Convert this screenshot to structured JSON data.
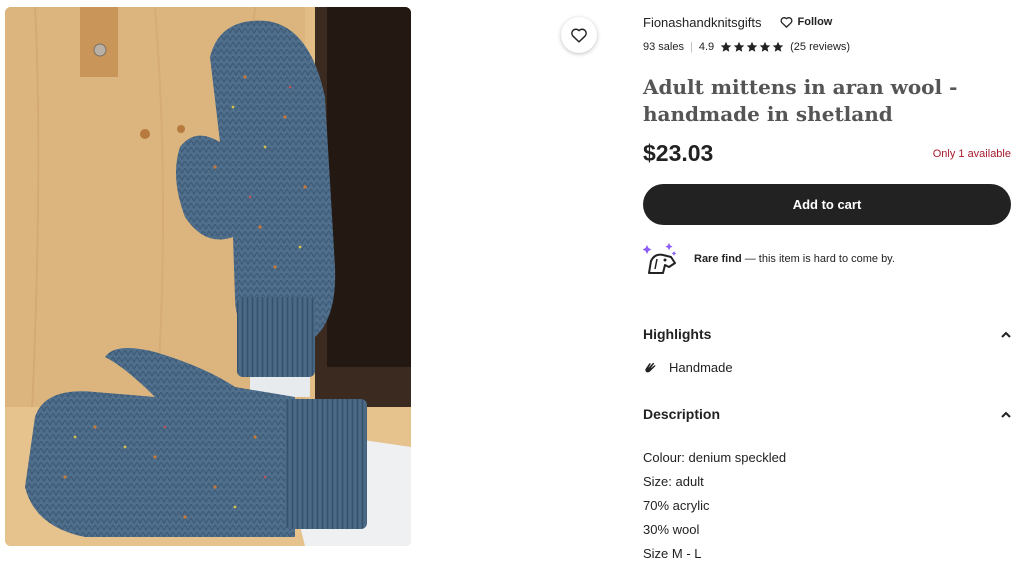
{
  "shop": {
    "name": "Fionashandknitsgifts",
    "follow_label": "Follow"
  },
  "stats": {
    "sales": "93 sales",
    "rating": "4.9",
    "reviews": "(25 reviews)"
  },
  "product": {
    "title": "Adult mittens in aran wool - handmade in shetland",
    "price": "$23.03",
    "stock": "Only 1 available",
    "add_to_cart": "Add to cart"
  },
  "rare_find": {
    "title": "Rare find",
    "text": " — this item is hard to come by."
  },
  "highlights": {
    "label": "Highlights",
    "items": [
      "Handmade"
    ]
  },
  "description": {
    "label": "Description",
    "lines": [
      "Colour: denium speckled",
      "Size: adult",
      "70% acrylic",
      "30% wool",
      "Size M - L"
    ]
  },
  "colors": {
    "accent_dark": "#222222",
    "stock_red": "#a61a2e",
    "photo_wood": "#dcb57e",
    "mitten_blue": "#4f6f8c"
  },
  "icons": [
    "heart-icon",
    "star-icon",
    "rare-find-icon",
    "chevron-up-icon",
    "hand-icon"
  ]
}
